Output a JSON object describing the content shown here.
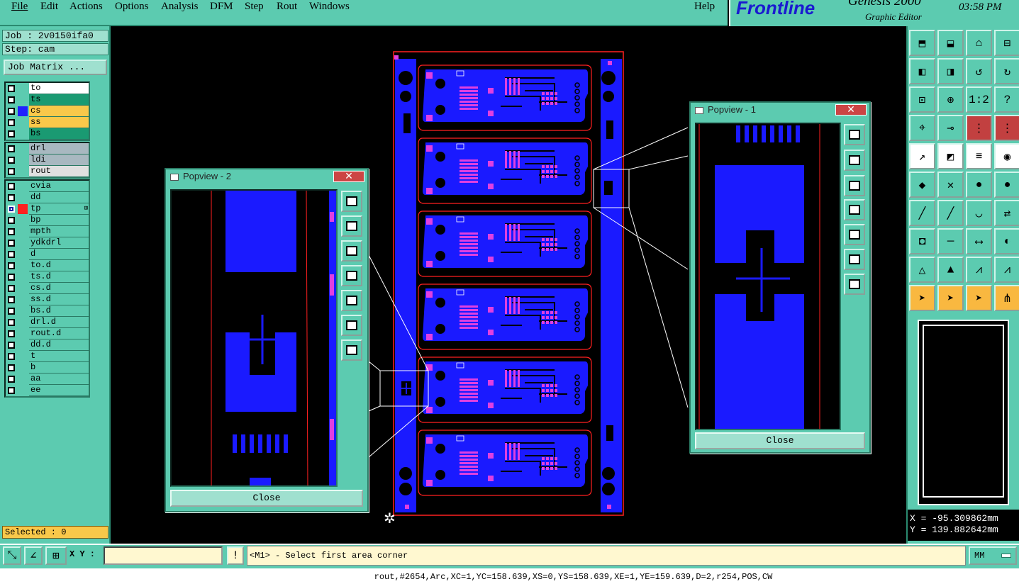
{
  "menu": [
    "File",
    "Edit",
    "Actions",
    "Options",
    "Analysis",
    "DFM",
    "Step",
    "Rout",
    "Windows"
  ],
  "help": "Help",
  "brand": {
    "logo": "Frontline",
    "product": "Genesis 2000",
    "subtitle": "Graphic Editor",
    "time": "03:58 PM"
  },
  "job": {
    "job_label": "Job : 2v0150ifa0",
    "step_label": "Step: cam",
    "matrix_button": "Job Matrix ..."
  },
  "layers": {
    "group1": [
      {
        "name": "to",
        "color": "#ffffff",
        "sw": ""
      },
      {
        "name": "ts",
        "color": "#1a9a72",
        "sw": ""
      },
      {
        "name": "cs",
        "color": "#f9c84a",
        "sw": "#2020ff"
      },
      {
        "name": "ss",
        "color": "#f9c84a",
        "sw": ""
      },
      {
        "name": "bs",
        "color": "#1a9a72",
        "sw": ""
      }
    ],
    "group2": [
      {
        "name": "drl",
        "color": "#a8b8c0"
      },
      {
        "name": "ldi",
        "color": "#a8b8c0"
      },
      {
        "name": "rout",
        "color": "#e0e0e0"
      }
    ],
    "group3": [
      "cvia",
      "dd",
      "tp",
      "bp",
      "mpth",
      "ydkdrl",
      "d",
      "to.d",
      "ts.d",
      "cs.d",
      "ss.d",
      "bs.d",
      "drl.d",
      "rout.d",
      "dd.d",
      "t",
      "b",
      "aa",
      "ee"
    ]
  },
  "selected": "Selected : 0",
  "popview1": {
    "title": "Popview - 1",
    "close": "Close"
  },
  "popview2": {
    "title": "Popview - 2",
    "close": "Close"
  },
  "coords": {
    "x": "X = -95.309862mm",
    "y": "Y = 139.882642mm"
  },
  "bottom": {
    "xy_label": "X Y :",
    "input_value": "",
    "prompt": "<M1> - Select first area corner",
    "units": "MM"
  },
  "status": "rout,#2654,Arc,XC=1,YC=158.639,XS=0,YS=158.639,XE=1,YE=159.639,D=2,r254,POS,CW",
  "colors": {
    "panel": "#5ccbb0",
    "board": "#1a1aff",
    "pad": "#e040e0",
    "outline": "#ff2020"
  }
}
